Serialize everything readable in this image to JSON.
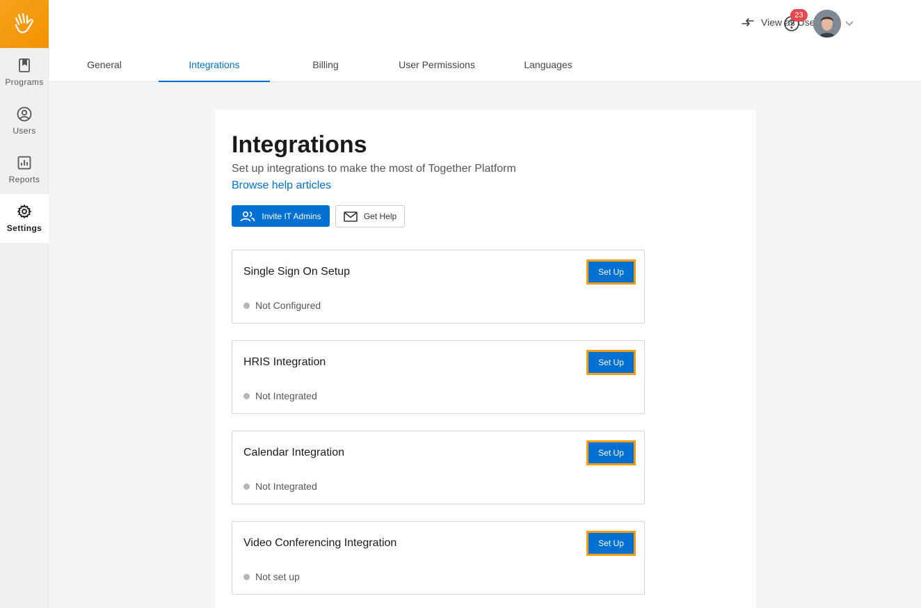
{
  "sidebar": {
    "items": [
      {
        "label": "Programs",
        "icon": "book-icon"
      },
      {
        "label": "Users",
        "icon": "user-circle-icon"
      },
      {
        "label": "Reports",
        "icon": "bar-chart-icon"
      },
      {
        "label": "Settings",
        "icon": "gear-icon",
        "active": true
      }
    ]
  },
  "topbar": {
    "view_as_user": "View as User",
    "notification_count": "23"
  },
  "tabs": [
    {
      "label": "General"
    },
    {
      "label": "Integrations",
      "active": true
    },
    {
      "label": "Billing"
    },
    {
      "label": "User Permissions"
    },
    {
      "label": "Languages"
    }
  ],
  "main": {
    "title": "Integrations",
    "subtitle": "Set up integrations to make the most of Together Platform",
    "help_link": "Browse help articles",
    "invite_button": "Invite IT Admins",
    "get_help_button": "Get Help",
    "integrations": [
      {
        "title": "Single Sign On Setup",
        "status": "Not Configured",
        "button": "Set Up"
      },
      {
        "title": "HRIS Integration",
        "status": "Not Integrated",
        "button": "Set Up"
      },
      {
        "title": "Calendar Integration",
        "status": "Not Integrated",
        "button": "Set Up"
      },
      {
        "title": "Video Conferencing Integration",
        "status": "Not set up",
        "button": "Set Up"
      }
    ]
  },
  "colors": {
    "brand": "#f39200",
    "primary": "#0070d2",
    "highlight": "#f39c12"
  }
}
